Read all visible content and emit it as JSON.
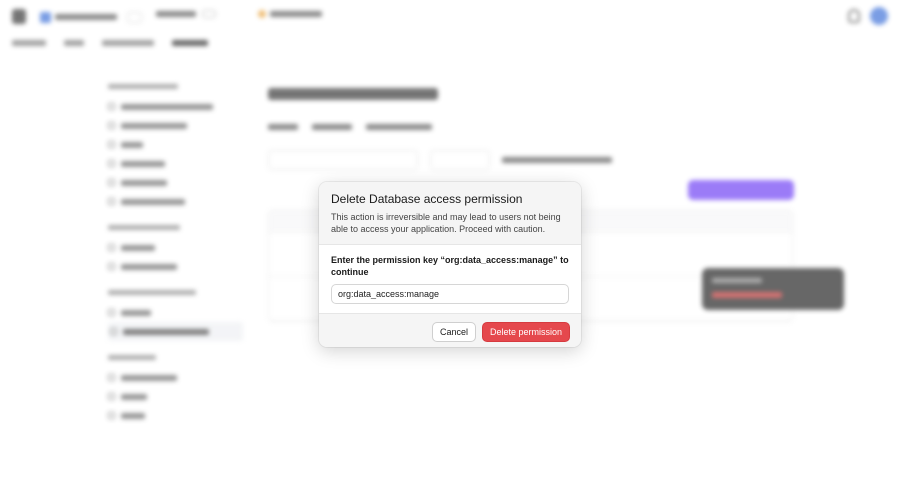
{
  "modal": {
    "title": "Delete Database access permission",
    "description": "This action is irreversible and may lead to users not being able to access your application. Proceed with caution.",
    "confirm_label": "Enter the permission key “org:data_access:manage” to continue",
    "input_value": "org:data_access:manage",
    "cancel_label": "Cancel",
    "delete_label": "Delete permission"
  },
  "colors": {
    "accent": "#6c3df5",
    "danger": "#e5484d"
  }
}
